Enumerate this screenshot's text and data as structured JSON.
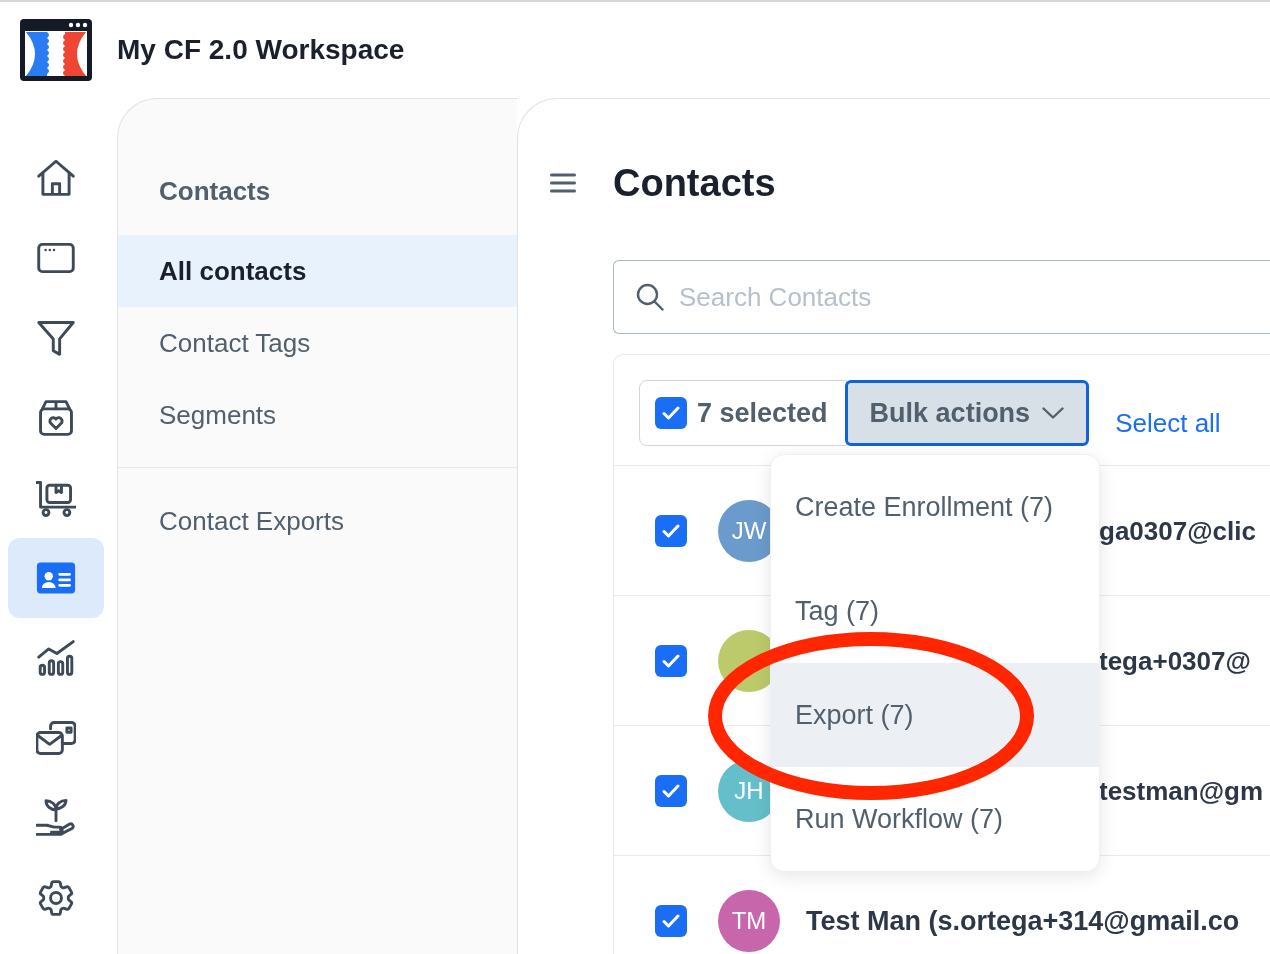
{
  "workspace": {
    "title": "My CF 2.0 Workspace"
  },
  "rail": {
    "items": [
      {
        "selected": false
      },
      {
        "selected": false
      },
      {
        "selected": false
      },
      {
        "selected": false
      },
      {
        "selected": false
      },
      {
        "selected": true
      },
      {
        "selected": false
      },
      {
        "selected": false
      },
      {
        "selected": false
      },
      {
        "selected": false
      }
    ]
  },
  "nav": {
    "heading": "Contacts",
    "items": [
      {
        "label": "All contacts",
        "selected": true
      },
      {
        "label": "Contact Tags",
        "selected": false
      },
      {
        "label": "Segments",
        "selected": false
      }
    ],
    "more_items": [
      {
        "label": "Contact Exports",
        "selected": false
      }
    ]
  },
  "main": {
    "title": "Contacts",
    "search": {
      "placeholder": "Search Contacts"
    },
    "toolbar": {
      "select_checked": true,
      "selected_count": "7 selected",
      "bulk_button": "Bulk actions",
      "select_all": "Select all"
    },
    "rows": [
      {
        "checked": true,
        "initials": "JW",
        "color": "#6b9bcc",
        "text": "ga0307@clic"
      },
      {
        "checked": true,
        "color": "#bdca6b",
        "text": "tega+0307@"
      },
      {
        "checked": true,
        "initials": "JH",
        "color": "#65bfca",
        "text": "testman@gm"
      },
      {
        "checked": true,
        "initials": "TM",
        "color": "#c866ab",
        "text": "Test Man (s.ortega+314@gmail.co"
      }
    ],
    "bulk_menu": {
      "items": [
        {
          "label": "Create Enrollment (7)",
          "selected": false
        },
        {
          "label": "Tag (7)",
          "selected": false
        },
        {
          "label": "Export (7)",
          "selected": true
        },
        {
          "label": "Run Workflow (7)",
          "selected": false
        }
      ]
    }
  },
  "annotations": [
    {
      "kind": "ellipse"
    }
  ]
}
